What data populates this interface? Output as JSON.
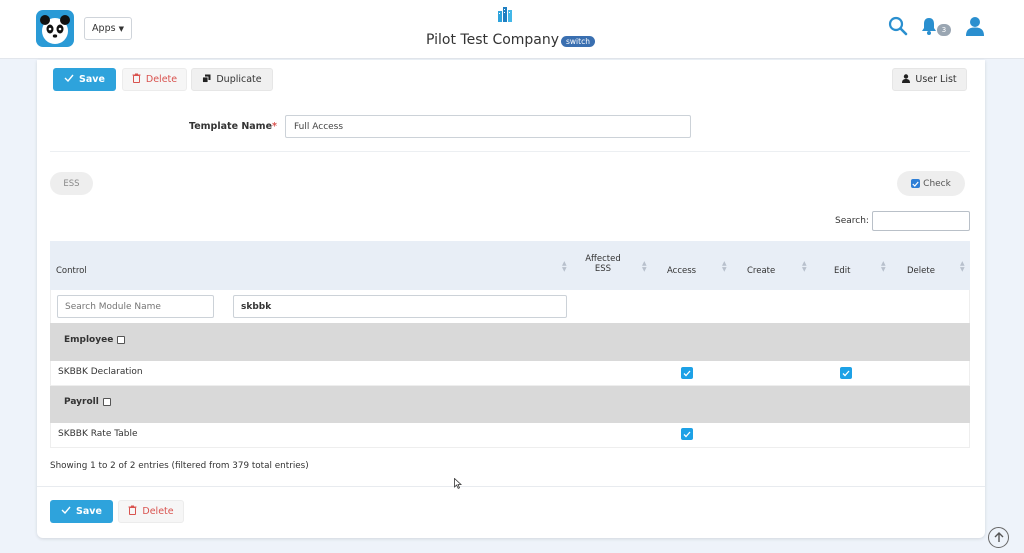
{
  "header": {
    "apps_label": "Apps",
    "company_name": "Pilot Test Company",
    "switch_label": "switch",
    "notification_count": "3",
    "icons": [
      "panda-logo",
      "buildings-icon",
      "search-icon",
      "bell-icon",
      "user-icon"
    ]
  },
  "toolbar": {
    "save_label": "Save",
    "delete_label": "Delete",
    "duplicate_label": "Duplicate",
    "user_list_label": "User List"
  },
  "form": {
    "template_name_label": "Template Name",
    "required_mark": "*",
    "template_name_value": "Full Access"
  },
  "tabs": {
    "ess_label": "ESS",
    "check_label": "Check",
    "check_checked": true
  },
  "search": {
    "label": "Search:",
    "value": ""
  },
  "table": {
    "columns": {
      "control": "Control",
      "affected_ess_1": "Affected",
      "affected_ess_2": "ESS",
      "access": "Access",
      "create": "Create",
      "edit": "Edit",
      "delete": "Delete"
    },
    "filters": {
      "module_placeholder": "Search Module Name",
      "control_value": "skbbk"
    },
    "groups": [
      {
        "name": "Employee",
        "checked": false,
        "rows": [
          {
            "control": "SKBBK Declaration",
            "access": true,
            "create": false,
            "edit": true,
            "delete": false
          }
        ]
      },
      {
        "name": "Payroll",
        "checked": false,
        "rows": [
          {
            "control": "SKBBK Rate Table",
            "access": true,
            "create": false,
            "edit": false,
            "delete": false
          }
        ]
      }
    ],
    "info": "Showing 1 to 2 of 2 entries (filtered from 379 total entries)"
  },
  "footer": {
    "save_label": "Save",
    "delete_label": "Delete"
  },
  "colors": {
    "primary": "#2ea3dc",
    "danger": "#d9534f",
    "header_row": "#e8eef6",
    "group_row": "#d9d9d9",
    "page_bg": "#eef3fa"
  }
}
